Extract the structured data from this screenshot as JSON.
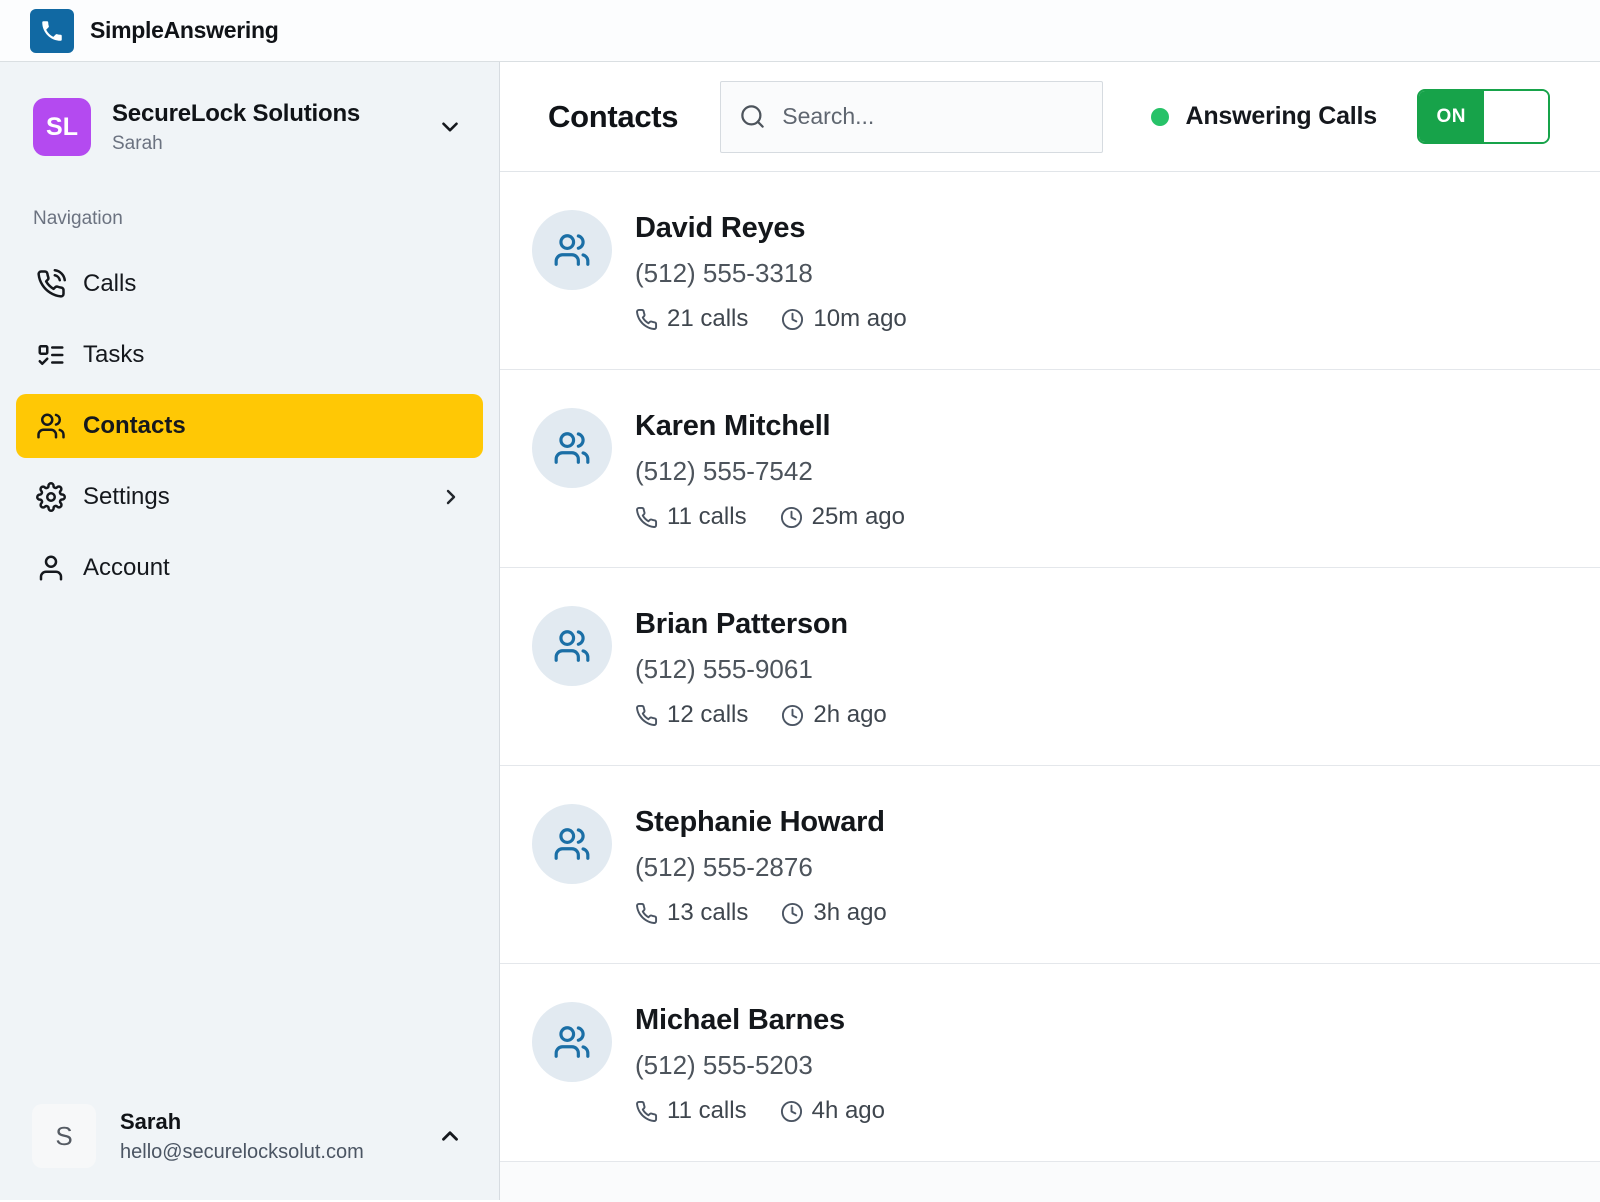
{
  "app": {
    "title": "SimpleAnswering",
    "logo_icon": "phone-icon"
  },
  "sidebar": {
    "org": {
      "initials": "SL",
      "name": "SecureLock Solutions",
      "subtitle": "Sarah"
    },
    "nav_label": "Navigation",
    "items": [
      {
        "label": "Calls",
        "icon": "phone-call-icon",
        "active": false
      },
      {
        "label": "Tasks",
        "icon": "task-list-icon",
        "active": false
      },
      {
        "label": "Contacts",
        "icon": "users-icon",
        "active": true
      },
      {
        "label": "Settings",
        "icon": "gear-icon",
        "active": false,
        "has_submenu": true
      },
      {
        "label": "Account",
        "icon": "user-icon",
        "active": false
      }
    ],
    "user": {
      "initial": "S",
      "name": "Sarah",
      "email": "hello@securelocksolut.com"
    }
  },
  "header": {
    "title": "Contacts",
    "search_placeholder": "Search...",
    "search_value": "",
    "status_label": "Answering Calls",
    "toggle_state": "ON"
  },
  "contacts": [
    {
      "name": "David Reyes",
      "phone": "(512) 555-3318",
      "calls": "21 calls",
      "last_call": "10m ago"
    },
    {
      "name": "Karen Mitchell",
      "phone": "(512) 555-7542",
      "calls": "11 calls",
      "last_call": "25m ago"
    },
    {
      "name": "Brian Patterson",
      "phone": "(512) 555-9061",
      "calls": "12 calls",
      "last_call": "2h ago"
    },
    {
      "name": "Stephanie Howard",
      "phone": "(512) 555-2876",
      "calls": "13 calls",
      "last_call": "3h ago"
    },
    {
      "name": "Michael Barnes",
      "phone": "(512) 555-5203",
      "calls": "11 calls",
      "last_call": "4h ago"
    }
  ],
  "colors": {
    "brand_blue": "#1169a3",
    "org_avatar_purple": "#b44af0",
    "active_nav_yellow": "#ffc805",
    "toggle_green": "#17a34a",
    "status_dot_green": "#27c268",
    "contact_avatar_bg": "#e2eaf1",
    "contact_avatar_icon_blue": "#1b6fa6",
    "sidebar_bg": "#f0f4f7"
  }
}
